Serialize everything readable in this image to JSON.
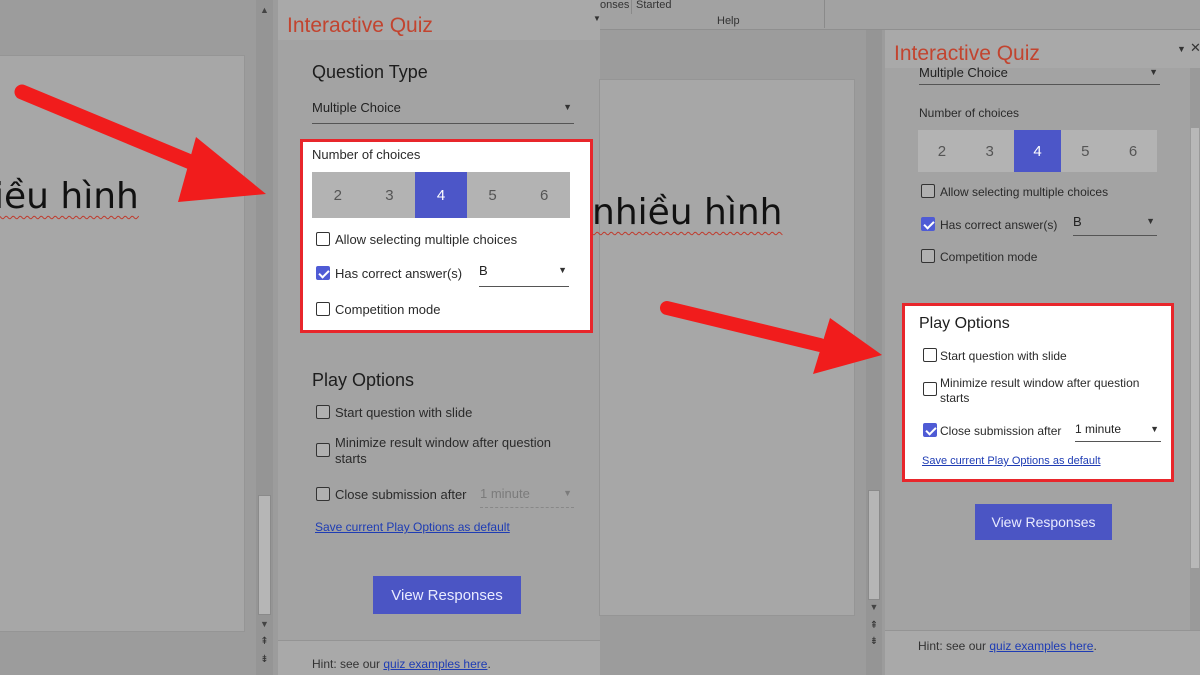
{
  "left": {
    "slide_text": "iều hình",
    "pane": {
      "title": "Interactive Quiz",
      "question_type_heading": "Question Type",
      "question_type_value": "Multiple Choice",
      "number_of_choices_label": "Number of choices",
      "choices": [
        "2",
        "3",
        "4",
        "5",
        "6"
      ],
      "selected_choice": "4",
      "allow_multiple_label": "Allow selecting multiple choices",
      "has_correct_label": "Has correct answer(s)",
      "correct_answer_value": "B",
      "competition_label": "Competition mode",
      "play_options_heading": "Play Options",
      "start_with_slide_label": "Start question with slide",
      "minimize_label_line1": "Minimize result window after question",
      "minimize_label_line2": "starts",
      "close_submission_label": "Close submission after",
      "close_submission_value": "1 minute",
      "save_default_link": "Save current Play Options as default",
      "view_responses_button": "View Responses",
      "hint_prefix": "Hint: see our ",
      "hint_link": "quiz examples here",
      "hint_suffix": "."
    }
  },
  "right": {
    "ribbon": {
      "item1": "onses",
      "item2": "Started",
      "group_label": "Help"
    },
    "slide_text": "nhiều hình",
    "pane": {
      "title": "Interactive Quiz",
      "question_type_value": "Multiple Choice",
      "number_of_choices_label": "Number of choices",
      "choices": [
        "2",
        "3",
        "4",
        "5",
        "6"
      ],
      "selected_choice": "4",
      "allow_multiple_label": "Allow selecting multiple choices",
      "has_correct_label": "Has correct answer(s)",
      "correct_answer_value": "B",
      "competition_label": "Competition mode",
      "play_options_heading": "Play Options",
      "start_with_slide_label": "Start question with slide",
      "minimize_label_line1": "Minimize result window after question",
      "minimize_label_line2": "starts",
      "close_submission_label": "Close submission after",
      "close_submission_value": "1 minute",
      "save_default_link": "Save current Play Options as default",
      "view_responses_button": "View Responses",
      "hint_prefix": "Hint: see our ",
      "hint_link": "quiz examples here",
      "hint_suffix": "."
    }
  },
  "colors": {
    "accent": "#4c56c8",
    "title": "#c2442f",
    "highlight_border": "#e8262b",
    "arrow": "#f11c1c"
  }
}
